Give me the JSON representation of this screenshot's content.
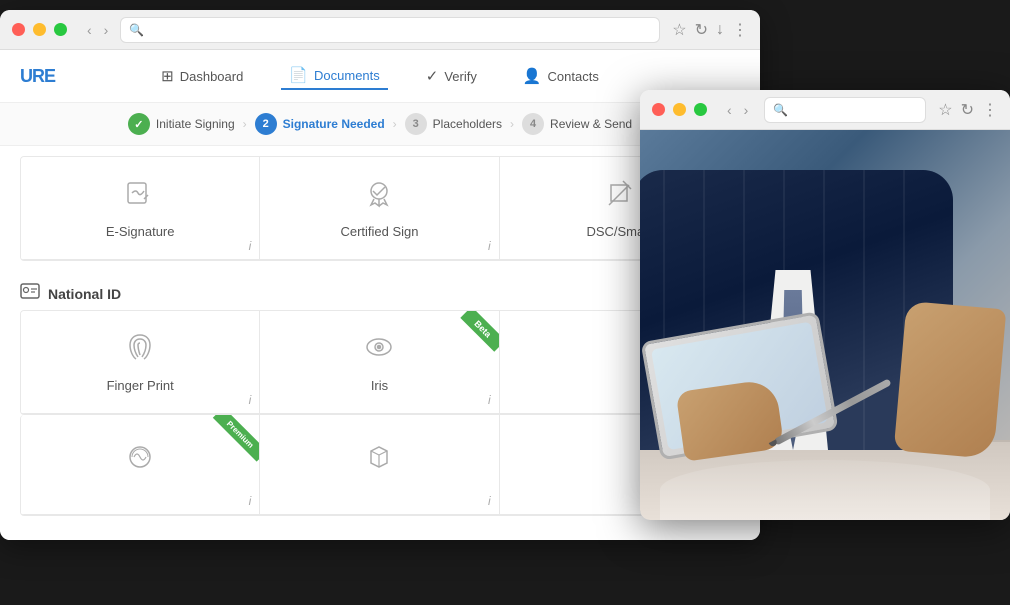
{
  "mainWindow": {
    "brand": "URE",
    "nav": {
      "items": [
        {
          "label": "Dashboard",
          "icon": "⊞",
          "active": false
        },
        {
          "label": "Documents",
          "icon": "📄",
          "active": true
        },
        {
          "label": "Verify",
          "icon": "✓",
          "active": false
        },
        {
          "label": "Contacts",
          "icon": "👤",
          "active": false
        }
      ]
    },
    "steps": [
      {
        "number": "✓",
        "label": "Initiate Signing",
        "state": "done"
      },
      {
        "number": "2",
        "label": "Signature Needed",
        "state": "active"
      },
      {
        "number": "3",
        "label": "Placeholders",
        "state": "inactive"
      },
      {
        "number": "4",
        "label": "Review & Send",
        "state": "inactive"
      }
    ],
    "section1": {
      "cards": [
        {
          "label": "E-Signature",
          "badge": null
        },
        {
          "label": "Certified Sign",
          "badge": null
        },
        {
          "label": "DSC/Smart",
          "badge": null
        }
      ]
    },
    "section2": {
      "title": "National ID",
      "cards": [
        {
          "label": "Finger Print",
          "badge": null
        },
        {
          "label": "Iris",
          "badge": "Beta"
        },
        {
          "label": "",
          "badge": null
        }
      ]
    },
    "section3": {
      "cards": [
        {
          "label": "",
          "badge": "Premium"
        },
        {
          "label": "",
          "badge": null
        },
        {
          "label": "",
          "badge": null
        }
      ]
    }
  },
  "overlayWindow": {
    "imageAlt": "Business person signing document on tablet"
  },
  "toolbar": {
    "back": "‹",
    "forward": "›",
    "refresh": "↻",
    "download": "↓",
    "more": "⋮",
    "bookmark": "☆",
    "search": "🔍"
  },
  "info_label": "i"
}
